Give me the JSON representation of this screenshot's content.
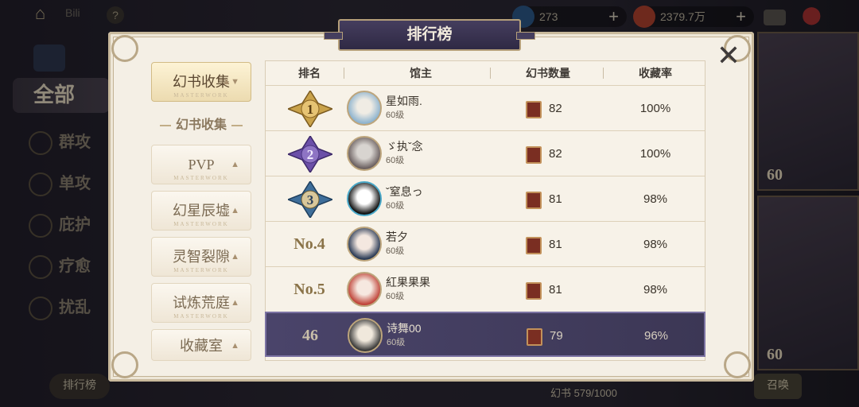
{
  "top_bar": {
    "username": "Bili",
    "help_icon": "?",
    "currency1_value": "273",
    "currency2_value": "2379.7万",
    "add_label": "+"
  },
  "side_menu": {
    "all_label": "全部",
    "items": [
      "群攻",
      "单攻",
      "庇护",
      "疗愈",
      "扰乱"
    ]
  },
  "right_cards": {
    "levels": [
      "60",
      "60"
    ]
  },
  "bottom_bar": {
    "left_button": "排行榜",
    "book_count": "幻书 579/1000",
    "right_button": "召唤"
  },
  "panel": {
    "title": "排行榜",
    "category_header": "幻书收集",
    "categories": [
      {
        "label": "幻书收集",
        "sub": "MASTERWORK",
        "active": true
      },
      {
        "label": "PVP",
        "sub": "MASTERWORK",
        "active": false
      },
      {
        "label": "幻星辰墟",
        "sub": "MASTERWORK",
        "active": false
      },
      {
        "label": "灵智裂隙",
        "sub": "MASTERWORK",
        "active": false
      },
      {
        "label": "试炼荒庭",
        "sub": "MASTERWORK",
        "active": false
      },
      {
        "label": "收藏室",
        "sub": "MASTERWORK",
        "active": false
      }
    ],
    "columns": [
      "排名",
      "馆主",
      "幻书数量",
      "收藏率"
    ],
    "rows": [
      {
        "rank": "1",
        "badge": "gold",
        "name": "星如雨.",
        "level": "60级",
        "count": "82",
        "rate": "100%"
      },
      {
        "rank": "2",
        "badge": "purple",
        "name": "ゞ执ˇ念",
        "level": "60级",
        "count": "82",
        "rate": "100%"
      },
      {
        "rank": "3",
        "badge": "blue",
        "name": "ˇ窒息っ",
        "level": "60级",
        "count": "81",
        "rate": "98%"
      },
      {
        "rank": "No.4",
        "badge": "",
        "name": "若夕",
        "level": "60级",
        "count": "81",
        "rate": "98%"
      },
      {
        "rank": "No.5",
        "badge": "",
        "name": "紅果果果",
        "level": "60级",
        "count": "81",
        "rate": "98%"
      }
    ],
    "self_row": {
      "rank": "46",
      "name": "诗舞00",
      "level": "60级",
      "count": "79",
      "rate": "96%"
    }
  },
  "colors": {
    "panel_bg": "#f4efe5",
    "title_bg": "#3a3452",
    "self_row_bg": "#433d60",
    "gold": "#c9a24a",
    "purple": "#6b4fa8",
    "blue": "#3e6e9a"
  },
  "icons": [
    "home-icon",
    "help-icon",
    "gem-icon",
    "coin-icon",
    "mail-icon",
    "location-pin-icon",
    "close-icon",
    "book-icon",
    "rank-medal-icon"
  ]
}
